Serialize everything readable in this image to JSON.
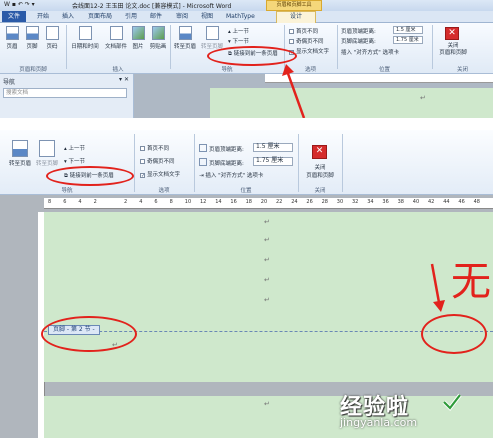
{
  "top": {
    "title": "会线面12-2  王玉田  论文.doc [兼容模式] - Microsoft Word",
    "context_tag": "页眉和页脚工具",
    "tabs": [
      "文件",
      "开始",
      "插入",
      "页面布局",
      "引用",
      "邮件",
      "审阅",
      "视图",
      "MathType",
      "设计"
    ],
    "buttons": [
      "页眉",
      "页脚",
      "页码",
      "日期和时间",
      "文档部件",
      "图片",
      "剪贴画",
      "转至页眉",
      "转至页脚"
    ],
    "groups": [
      "页眉和页脚",
      "插入",
      "导航",
      "选项",
      "位置",
      "关闭"
    ],
    "nav_small": [
      "上一节",
      "下一节",
      "链接到前一条页眉"
    ],
    "options": [
      "首页不同",
      "奇偶页不同",
      "显示文档文字"
    ],
    "header_dist_label": "页眉顶端距离:",
    "header_dist_value": "1.5 厘米",
    "footer_dist_label": "页脚底端距离:",
    "footer_dist_value": "1.75 厘米",
    "align_tab": "插入 \"对齐方式\" 选项卡",
    "close_label": "关闭\n页眉和页脚",
    "nav_pane_title": "导航",
    "nav_search_placeholder": "搜索文档"
  },
  "bottom": {
    "nav_buttons": [
      "转至页眉",
      "转至页脚"
    ],
    "nav_small": [
      "上一节",
      "下一节",
      "链接到前一条页眉"
    ],
    "nav_group": "导航",
    "options": [
      "首页不同",
      "奇偶页不同",
      "显示文档文字"
    ],
    "options_group": "选项",
    "header_dist_label": "页眉顶端距离:",
    "header_dist_value": "1.5 厘米",
    "footer_dist_label": "页脚底端距离:",
    "footer_dist_value": "1.75 厘米",
    "align_tab": "插入 \"对齐方式\" 选项卡",
    "position_group": "位置",
    "close_label_1": "关闭",
    "close_label_2": "页眉和页脚",
    "close_group": "关闭",
    "ruler_ticks": [
      "8",
      "6",
      "4",
      "2",
      "",
      "2",
      "4",
      "6",
      "8",
      "10",
      "12",
      "14",
      "16",
      "18",
      "20",
      "22",
      "24",
      "26",
      "28",
      "30",
      "32",
      "34",
      "36",
      "38",
      "40",
      "42",
      "44",
      "46",
      "48"
    ],
    "footer_tag": "页脚 - 第 2 节 -",
    "annotation_text": "无",
    "paragraph_mark": "↵"
  },
  "watermark": {
    "main": "经验啦",
    "url": "jingyanla.com"
  },
  "colors": {
    "page_green": "#cfe8cc",
    "annotation_red": "#e2221c",
    "ribbon_blue": "#dbe5f1"
  }
}
